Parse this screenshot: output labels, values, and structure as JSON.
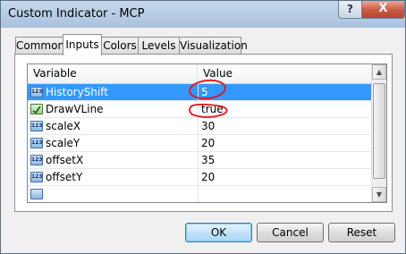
{
  "window": {
    "title": "Custom Indicator - MCP",
    "help_glyph": "?",
    "close_glyph": "X"
  },
  "tabs": [
    {
      "label": "Common"
    },
    {
      "label": "Inputs"
    },
    {
      "label": "Colors"
    },
    {
      "label": "Levels"
    },
    {
      "label": "Visualization"
    }
  ],
  "active_tab": "Inputs",
  "grid": {
    "headers": {
      "variable": "Variable",
      "value": "Value"
    },
    "rows": [
      {
        "icon": "numeric-icon",
        "badge": "123",
        "name": "HistoryShift",
        "value": "5",
        "selected": true
      },
      {
        "icon": "boolean-icon",
        "badge": "",
        "name": "DrawVLine",
        "value": "true",
        "selected": false
      },
      {
        "icon": "numeric-icon",
        "badge": "123",
        "name": "scaleX",
        "value": "30",
        "selected": false
      },
      {
        "icon": "numeric-icon",
        "badge": "123",
        "name": "scaleY",
        "value": "20",
        "selected": false
      },
      {
        "icon": "numeric-icon",
        "badge": "123",
        "name": "offsetX",
        "value": "35",
        "selected": false
      },
      {
        "icon": "numeric-icon",
        "badge": "123",
        "name": "offsetY",
        "value": "20",
        "selected": false
      }
    ]
  },
  "buttons": {
    "ok": "OK",
    "cancel": "Cancel",
    "reset": "Reset"
  },
  "colors": {
    "selection": "#3399ff",
    "annotation": "#e0141e"
  }
}
